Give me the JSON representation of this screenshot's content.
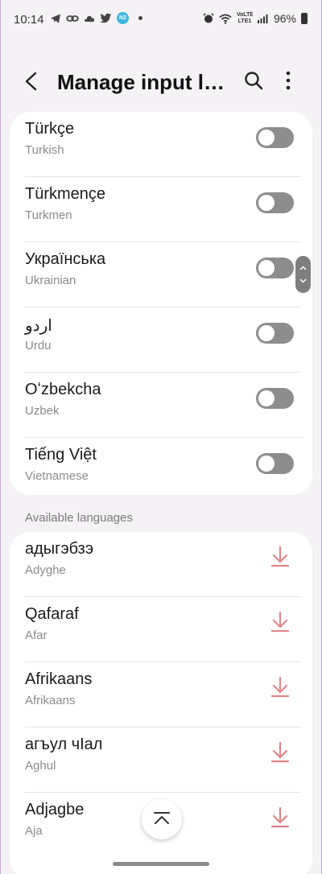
{
  "status_bar": {
    "time": "10:14",
    "left_icons": [
      "telegram-icon",
      "link-icon",
      "cloud-icon",
      "twitter-icon",
      "app-badge-icon",
      "dot-icon"
    ],
    "badge_text": "N2",
    "battery": "96%",
    "network": "VoLTE LTE1"
  },
  "header": {
    "title": "Manage input languages"
  },
  "installed_languages": [
    {
      "name": "Türkçe",
      "english": "Turkish",
      "enabled": false
    },
    {
      "name": "Türkmençe",
      "english": "Turkmen",
      "enabled": false
    },
    {
      "name": "Українська",
      "english": "Ukrainian",
      "enabled": false
    },
    {
      "name": "اردو",
      "english": "Urdu",
      "enabled": false
    },
    {
      "name": "Oʻzbekcha",
      "english": "Uzbek",
      "enabled": false
    },
    {
      "name": "Tiếng Việt",
      "english": "Vietnamese",
      "enabled": false
    }
  ],
  "available_section": {
    "label": "Available languages"
  },
  "available_languages": [
    {
      "name": "адыгэбзэ",
      "english": "Adyghe"
    },
    {
      "name": "Qafaraf",
      "english": "Afar"
    },
    {
      "name": "Afrikaans",
      "english": "Afrikaans"
    },
    {
      "name": "агъул чӀал",
      "english": "Aghul"
    },
    {
      "name": "Adjagbe",
      "english": "Aja"
    }
  ],
  "colors": {
    "background": "#f4f2f4",
    "card": "#ffffff",
    "toggle_off": "#8d8d8d",
    "download_accent": "#e0858a"
  }
}
